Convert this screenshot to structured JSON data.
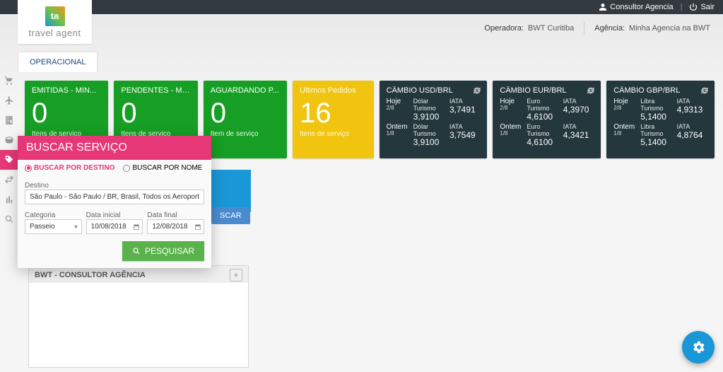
{
  "topbar": {
    "user_label": "Consultor Agencia",
    "logout_label": "Sair"
  },
  "infobar": {
    "operadora_label": "Operadora:",
    "operadora_value": "BWT Curitiba",
    "agencia_label": "Agência:",
    "agencia_value": "Minha Agencia na BWT"
  },
  "logo": {
    "abbr": "ta",
    "text": "travel agent"
  },
  "tabs": {
    "operacional": "OPERACIONAL"
  },
  "sidenav": {
    "items": [
      "cart",
      "plane",
      "building",
      "coins",
      "tag",
      "exchange",
      "chart",
      "search"
    ]
  },
  "cards": [
    {
      "kind": "green",
      "title": "EMITIDAS - MIN...",
      "value": "0",
      "sub": "Itens de serviço"
    },
    {
      "kind": "green",
      "title": "PENDENTES - MIN...",
      "value": "0",
      "sub": "Itens de serviço"
    },
    {
      "kind": "green",
      "title": "AGUARDANDO P...",
      "value": "0",
      "sub": "Item de serviço"
    },
    {
      "kind": "yellow",
      "title": "Últimos Pedidos",
      "value": "16",
      "sub": "Itens de serviço"
    }
  ],
  "exchange_cards": [
    {
      "title": "CÂMBIO USD/BRL",
      "today_label": "Hoje",
      "today_date": "2/8",
      "yest_label": "Ontem",
      "yest_date": "1/8",
      "col1": "Dólar Turismo",
      "col2": "IATA",
      "today_v1": "3,9100",
      "today_v2": "3,7491",
      "yest_v1": "3,9100",
      "yest_v2": "3,7549"
    },
    {
      "title": "CÂMBIO EUR/BRL",
      "today_label": "Hoje",
      "today_date": "2/8",
      "yest_label": "Ontem",
      "yest_date": "1/8",
      "col1": "Euro Turismo",
      "col2": "IATA",
      "today_v1": "4,6100",
      "today_v2": "4,3970",
      "yest_v1": "4,6100",
      "yest_v2": "4,3421"
    },
    {
      "title": "CÂMBIO GBP/BRL",
      "today_label": "Hoje",
      "today_date": "2/8",
      "yest_label": "Ontem",
      "yest_date": "1/8",
      "col1": "Libra Turismo",
      "col2": "IATA",
      "today_v1": "5,1400",
      "today_v2": "4,9313",
      "yest_v1": "5,1400",
      "yest_v2": "4,8764"
    }
  ],
  "popup": {
    "header": "BUSCAR SERVIÇO",
    "tab_destino": "BUSCAR POR DESTINO",
    "tab_nome": "BUSCAR POR NOME",
    "destino_label": "Destino",
    "destino_value": "São Paulo - São Paulo / BR, Brasil, Todos os Aeroportos (SAO)",
    "categoria_label": "Categoria",
    "categoria_value": "Passeio",
    "data_inicial_label": "Data inicial",
    "data_inicial_value": "10/08/2018",
    "data_final_label": "Data final",
    "data_final_value": "12/08/2018",
    "pesquisar_label": "PESQUISAR"
  },
  "buscar_button": "SCAR",
  "consultant": {
    "label": "BWT - CONSULTOR AGÊNCIA"
  }
}
